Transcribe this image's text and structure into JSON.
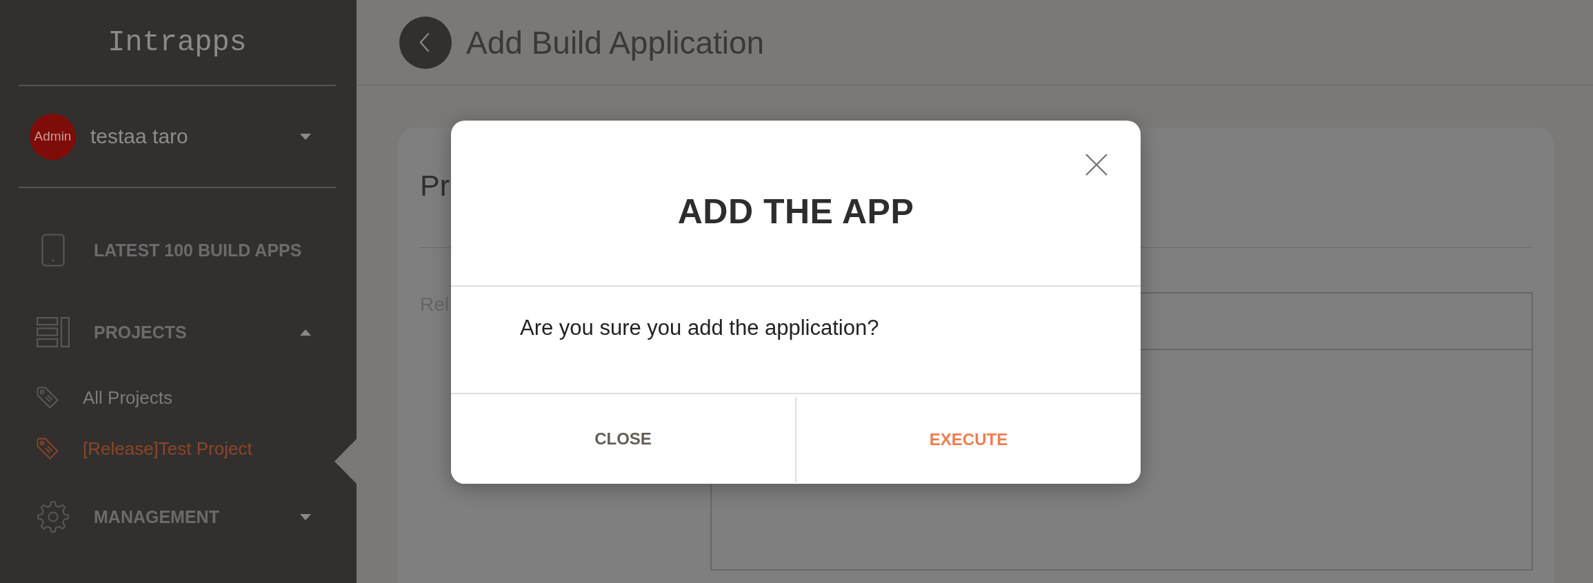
{
  "sidebar": {
    "logo": "Intrapps",
    "user": {
      "role_badge": "Admin",
      "name": "testaa taro",
      "expanded": false
    },
    "nav": [
      {
        "kind": "link",
        "label": "LATEST 100 BUILD APPS"
      },
      {
        "kind": "group",
        "label": "PROJECTS",
        "expanded": true,
        "children": [
          {
            "label": "All Projects",
            "selected": false
          },
          {
            "label": "[Release]Test Project",
            "selected": true
          }
        ]
      },
      {
        "kind": "group",
        "label": "MANAGEMENT",
        "expanded": false
      }
    ]
  },
  "header": {
    "title": "Add Build Application"
  },
  "card": {
    "title": "Pr",
    "field_label": "Rel"
  },
  "dialog": {
    "title": "ADD THE APP",
    "message": "Are you sure you add the application?",
    "buttons": [
      {
        "kind": "cancel",
        "label": "CLOSE"
      },
      {
        "kind": "confirm",
        "label": "EXECUTE"
      }
    ]
  }
}
